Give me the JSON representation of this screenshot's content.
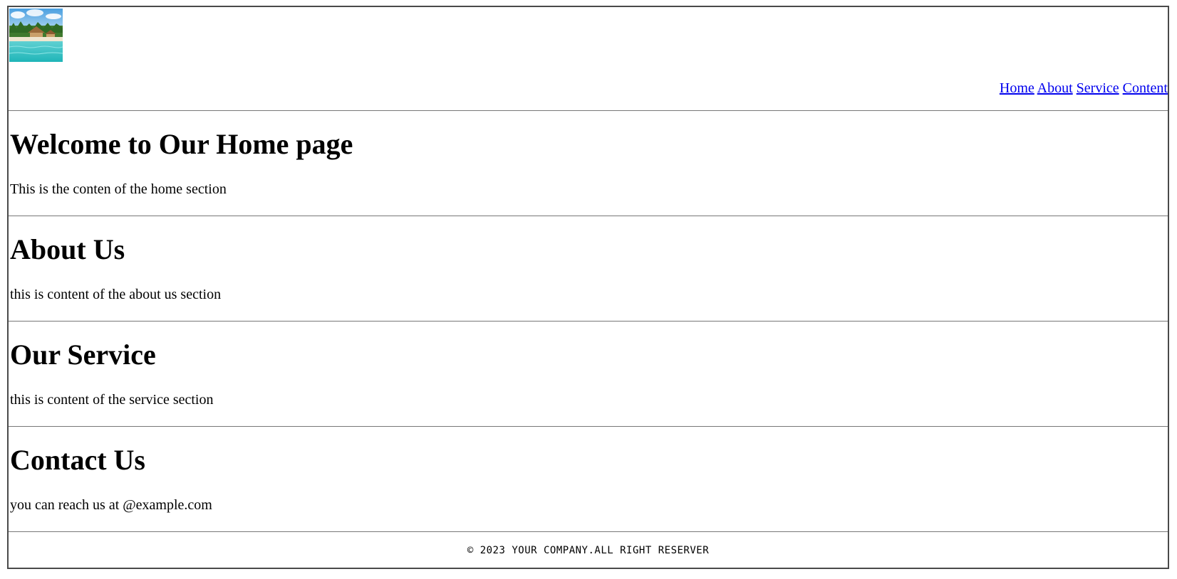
{
  "header": {
    "logo_alt": "beach resort logo",
    "nav": [
      {
        "label": "Home"
      },
      {
        "label": "About"
      },
      {
        "label": "Service"
      },
      {
        "label": "Content"
      }
    ]
  },
  "sections": {
    "home": {
      "title": "Welcome to Our Home page",
      "text": "This is the conten of the home section"
    },
    "about": {
      "title": "About Us",
      "text": "this is content of the about us section"
    },
    "service": {
      "title": "Our Service",
      "text": "this is content of the service section"
    },
    "contact": {
      "title": "Contact Us",
      "text": "you can reach us at @example.com"
    }
  },
  "footer": {
    "text": "© 2023 YOUR COMPANY.ALL RIGHT RESERVER"
  },
  "colors": {
    "link": "#0000ee",
    "border": "#4a4a4a",
    "divider": "#777777"
  }
}
